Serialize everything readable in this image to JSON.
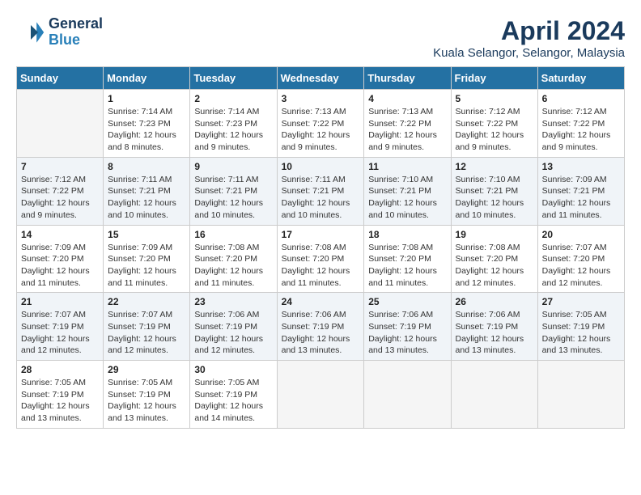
{
  "logo": {
    "line1": "General",
    "line2": "Blue"
  },
  "title": "April 2024",
  "location": "Kuala Selangor, Selangor, Malaysia",
  "days_header": [
    "Sunday",
    "Monday",
    "Tuesday",
    "Wednesday",
    "Thursday",
    "Friday",
    "Saturday"
  ],
  "weeks": [
    [
      {
        "num": "",
        "empty": true
      },
      {
        "num": "1",
        "sunrise": "7:14 AM",
        "sunset": "7:23 PM",
        "daylight": "12 hours and 8 minutes."
      },
      {
        "num": "2",
        "sunrise": "7:14 AM",
        "sunset": "7:23 PM",
        "daylight": "12 hours and 9 minutes."
      },
      {
        "num": "3",
        "sunrise": "7:13 AM",
        "sunset": "7:22 PM",
        "daylight": "12 hours and 9 minutes."
      },
      {
        "num": "4",
        "sunrise": "7:13 AM",
        "sunset": "7:22 PM",
        "daylight": "12 hours and 9 minutes."
      },
      {
        "num": "5",
        "sunrise": "7:12 AM",
        "sunset": "7:22 PM",
        "daylight": "12 hours and 9 minutes."
      },
      {
        "num": "6",
        "sunrise": "7:12 AM",
        "sunset": "7:22 PM",
        "daylight": "12 hours and 9 minutes."
      }
    ],
    [
      {
        "num": "7",
        "sunrise": "7:12 AM",
        "sunset": "7:22 PM",
        "daylight": "12 hours and 9 minutes."
      },
      {
        "num": "8",
        "sunrise": "7:11 AM",
        "sunset": "7:21 PM",
        "daylight": "12 hours and 10 minutes."
      },
      {
        "num": "9",
        "sunrise": "7:11 AM",
        "sunset": "7:21 PM",
        "daylight": "12 hours and 10 minutes."
      },
      {
        "num": "10",
        "sunrise": "7:11 AM",
        "sunset": "7:21 PM",
        "daylight": "12 hours and 10 minutes."
      },
      {
        "num": "11",
        "sunrise": "7:10 AM",
        "sunset": "7:21 PM",
        "daylight": "12 hours and 10 minutes."
      },
      {
        "num": "12",
        "sunrise": "7:10 AM",
        "sunset": "7:21 PM",
        "daylight": "12 hours and 10 minutes."
      },
      {
        "num": "13",
        "sunrise": "7:09 AM",
        "sunset": "7:21 PM",
        "daylight": "12 hours and 11 minutes."
      }
    ],
    [
      {
        "num": "14",
        "sunrise": "7:09 AM",
        "sunset": "7:20 PM",
        "daylight": "12 hours and 11 minutes."
      },
      {
        "num": "15",
        "sunrise": "7:09 AM",
        "sunset": "7:20 PM",
        "daylight": "12 hours and 11 minutes."
      },
      {
        "num": "16",
        "sunrise": "7:08 AM",
        "sunset": "7:20 PM",
        "daylight": "12 hours and 11 minutes."
      },
      {
        "num": "17",
        "sunrise": "7:08 AM",
        "sunset": "7:20 PM",
        "daylight": "12 hours and 11 minutes."
      },
      {
        "num": "18",
        "sunrise": "7:08 AM",
        "sunset": "7:20 PM",
        "daylight": "12 hours and 11 minutes."
      },
      {
        "num": "19",
        "sunrise": "7:08 AM",
        "sunset": "7:20 PM",
        "daylight": "12 hours and 12 minutes."
      },
      {
        "num": "20",
        "sunrise": "7:07 AM",
        "sunset": "7:20 PM",
        "daylight": "12 hours and 12 minutes."
      }
    ],
    [
      {
        "num": "21",
        "sunrise": "7:07 AM",
        "sunset": "7:19 PM",
        "daylight": "12 hours and 12 minutes."
      },
      {
        "num": "22",
        "sunrise": "7:07 AM",
        "sunset": "7:19 PM",
        "daylight": "12 hours and 12 minutes."
      },
      {
        "num": "23",
        "sunrise": "7:06 AM",
        "sunset": "7:19 PM",
        "daylight": "12 hours and 12 minutes."
      },
      {
        "num": "24",
        "sunrise": "7:06 AM",
        "sunset": "7:19 PM",
        "daylight": "12 hours and 13 minutes."
      },
      {
        "num": "25",
        "sunrise": "7:06 AM",
        "sunset": "7:19 PM",
        "daylight": "12 hours and 13 minutes."
      },
      {
        "num": "26",
        "sunrise": "7:06 AM",
        "sunset": "7:19 PM",
        "daylight": "12 hours and 13 minutes."
      },
      {
        "num": "27",
        "sunrise": "7:05 AM",
        "sunset": "7:19 PM",
        "daylight": "12 hours and 13 minutes."
      }
    ],
    [
      {
        "num": "28",
        "sunrise": "7:05 AM",
        "sunset": "7:19 PM",
        "daylight": "12 hours and 13 minutes."
      },
      {
        "num": "29",
        "sunrise": "7:05 AM",
        "sunset": "7:19 PM",
        "daylight": "12 hours and 13 minutes."
      },
      {
        "num": "30",
        "sunrise": "7:05 AM",
        "sunset": "7:19 PM",
        "daylight": "12 hours and 14 minutes."
      },
      {
        "num": "",
        "empty": true
      },
      {
        "num": "",
        "empty": true
      },
      {
        "num": "",
        "empty": true
      },
      {
        "num": "",
        "empty": true
      }
    ]
  ],
  "labels": {
    "sunrise": "Sunrise:",
    "sunset": "Sunset:",
    "daylight": "Daylight:"
  }
}
